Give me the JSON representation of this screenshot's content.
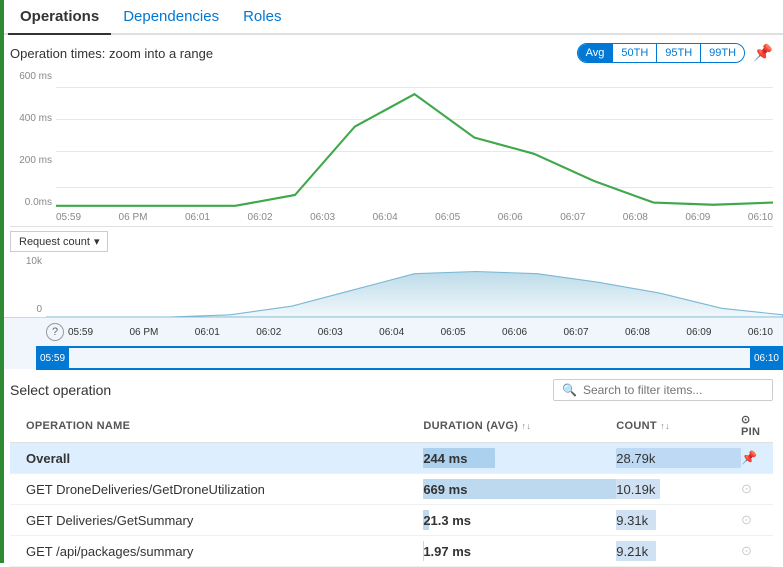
{
  "tabs": [
    {
      "label": "Operations",
      "active": true
    },
    {
      "label": "Dependencies",
      "active": false
    },
    {
      "label": "Roles",
      "active": false
    }
  ],
  "chart": {
    "title": "Operation times: zoom into a range",
    "stat_buttons": [
      "Avg",
      "50TH",
      "95TH",
      "99TH"
    ],
    "active_stat": "Avg",
    "y_labels": [
      "600 ms",
      "400 ms",
      "200 ms",
      "0.0ms"
    ],
    "x_labels": [
      "05:59",
      "06 PM",
      "06:01",
      "06:02",
      "06:03",
      "06:04",
      "06:05",
      "06:06",
      "06:07",
      "06:08",
      "06:09",
      "06:10"
    ]
  },
  "request_chart": {
    "button_label": "Request count",
    "y_labels": [
      "10k",
      "0"
    ]
  },
  "timeline": {
    "labels": [
      "05:59",
      "06 PM",
      "06:01",
      "06:02",
      "06:03",
      "06:04",
      "06:05",
      "06:06",
      "06:07",
      "06:08",
      "06:09",
      "06:10"
    ],
    "handle_left": "05:59",
    "handle_right": "06:10"
  },
  "ops_section": {
    "title": "Select operation",
    "search_placeholder": "Search to filter items...",
    "table": {
      "columns": [
        {
          "label": "OPERATION NAME",
          "sortable": false
        },
        {
          "label": "DURATION (AVG)",
          "sortable": true
        },
        {
          "label": "COUNT",
          "sortable": true
        },
        {
          "label": "PIN",
          "sortable": false
        }
      ],
      "rows": [
        {
          "name": "Overall",
          "duration": "244 ms",
          "duration_pct": 37,
          "count": "28.79k",
          "count_pct": 100,
          "selected": true,
          "indicator": true
        },
        {
          "name": "GET DroneDeliveries/GetDroneUtilization",
          "duration": "669 ms",
          "duration_pct": 100,
          "count": "10.19k",
          "count_pct": 35,
          "selected": false,
          "indicator": false
        },
        {
          "name": "GET Deliveries/GetSummary",
          "duration": "21.3 ms",
          "duration_pct": 3,
          "count": "9.31k",
          "count_pct": 32,
          "selected": false,
          "indicator": false
        },
        {
          "name": "GET /api/packages/summary",
          "duration": "1.97 ms",
          "duration_pct": 0.3,
          "count": "9.21k",
          "count_pct": 32,
          "selected": false,
          "indicator": false
        }
      ]
    }
  }
}
